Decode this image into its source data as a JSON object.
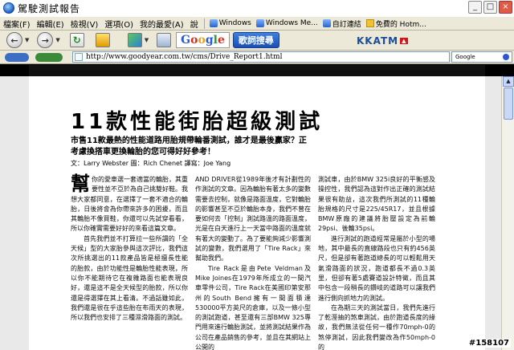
{
  "window": {
    "title": "駕駛測試報告"
  },
  "menubar": {
    "items": [
      "檔案(F)",
      "編輯(E)",
      "檢視(V)",
      "選項(O)",
      "我的最愛(A)",
      "說"
    ],
    "links": [
      "Windows",
      "Windows Me...",
      "自訂連結",
      "免費的 Hotm..."
    ]
  },
  "toolbar": {
    "google": "Google",
    "music": "歌詞搜尋",
    "kkatm": "KKATM"
  },
  "address": {
    "url": "http://www.goodyear.com.tw/cms/Drive_Report1.html",
    "search_label": "Google"
  },
  "article": {
    "headline": "11款性能街胎超級測試",
    "subhead": "市售11款最熱的性能道路用胎規帶輪番測試，誰才是最後贏家？正考慮換搭車更換輪胎的您可得好好參考！",
    "byline": "文：Larry Webster 圖：Rich Chenet 譯寫：Joe Yang",
    "col1": {
      "dropcap": "幫",
      "p1": "你的愛車選一套適當的輪胎，其重要性並不亞於為自己挑雙好鞋。我想大家都同意，在選擇了一套不適合的輪胎，日後將會為你帶來許多的困擾，而且其輪胎不像買鞋，你還可以先試穿看看，所以你確實需要好好的來看這篇文章。",
      "p2": "首先我們並不打算拉一些所謂的「全天候」型的大家胎參與這次評比，我們這次所挑選出的11款產品皆是極擅長性能的胎款，由於功能性是輪胎性能表現，所以你不能期待它在複雜路面也能表現良好，還是這不是全天候型的胎款，所以你還是得選擇在其上看清。不過話雖如此，我們還是很在乎這些胎在布雨天的表現，所以我們也安排了三種濕滑路面的測試。"
    },
    "col2": {
      "p1": "AND DRIVER從1989年後才有計劃性的作測試的文章。因為輪胎有著太多的變數需要去控制，就像是路面溫度，它對輪胎的影響甚至不亞於輪胎本身，我們不曾在要如何去「控制」測試路溫的路面溫度，光是在白天進行上一天當中路面的溫度就有著大的變動了。為了要能夠減少影響測試的變數，我們選用了「Tire Rack」來幫助我們。",
      "p2": "Tire Rack是由Pete Veldman及Mike Joines在1979年所成立的一間汽車零件公司，Tire Rack在美國印第安那州的South Bend擁有一間面積達530000平方英尺的倉庫，以及一條小型的測試跑道，甚至還有三部BMW 325專門用來進行輪胎測試，並將測試結果作為公司在產品銷售的參考，並且在其網站上公開的"
    },
    "col3": {
      "p1": "測試車，由於BMW 325i良好的平衡感及操控性，我們認為這對作出正確的測試結果很有助益，這次我們所測試的11種輪胎規格的尺寸是225/45R17，並且根據BMW原廠的建議將胎壓設定為前輪29psi、後輪35psi。",
      "p2": "進行測試的跑道經常是屬於小型的場地，其中最長的直線路段也只有約456英尺，但是卻有著跑道總長的可以輕鬆用天氣滑路面的狀況，跑道都長不過0.3英里，但卻有著5處賽道設計特徵，而且其中包含一段稍長的鑽岐的道路可以讓我們進行側向抓地力的測試。",
      "p3": "在為期三天的測試當日，我們先進行了乾溼抽的煞車測試，由於跑道長度的緣故，我們無法從任何一種作70mph-0的煞停測試，因此我們變改為作50mph-0的"
    }
  },
  "watermark": "#158107"
}
